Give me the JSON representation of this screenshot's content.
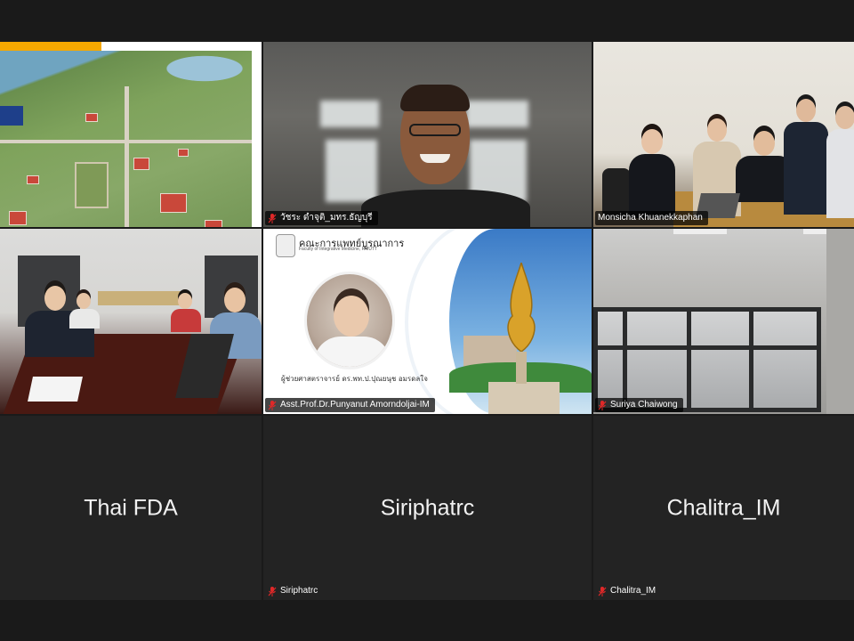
{
  "participants": {
    "campus": {
      "name": ""
    },
    "p1": {
      "name": "วัชระ ดำจุติ_มทร.ธัญบุรี",
      "muted": true
    },
    "p2": {
      "name": "Monsicha Khuanekkaphan",
      "muted": false
    },
    "p3": {
      "name": "",
      "active_speaker": true
    },
    "p4": {
      "name": "Asst.Prof.Dr.Punyanut Amorndoljai-IM",
      "muted": true,
      "poster_title": "คณะการแพทย์บูรณาการ",
      "poster_subtitle": "Faculty of Integrative Medicine, RMUTT",
      "poster_caption": "ผู้ช่วยศาสตราจารย์ ดร.พท.ป.ปุณยนุช อมรดลใจ"
    },
    "p5": {
      "name": "Suriya Chaiwong",
      "muted": true
    },
    "p6": {
      "display_name": "Thai FDA"
    },
    "p7": {
      "display_name": "Siriphatrc",
      "name": "Siriphatrc",
      "muted": true
    },
    "p8": {
      "display_name": "Chalitra_IM",
      "name": "Chalitra_IM",
      "muted": true
    }
  },
  "colors": {
    "active_border": "#23d959",
    "mic_muted": "#e02828",
    "tile_bg": "#232323"
  },
  "icons": {
    "mic": "mic-off-icon"
  }
}
